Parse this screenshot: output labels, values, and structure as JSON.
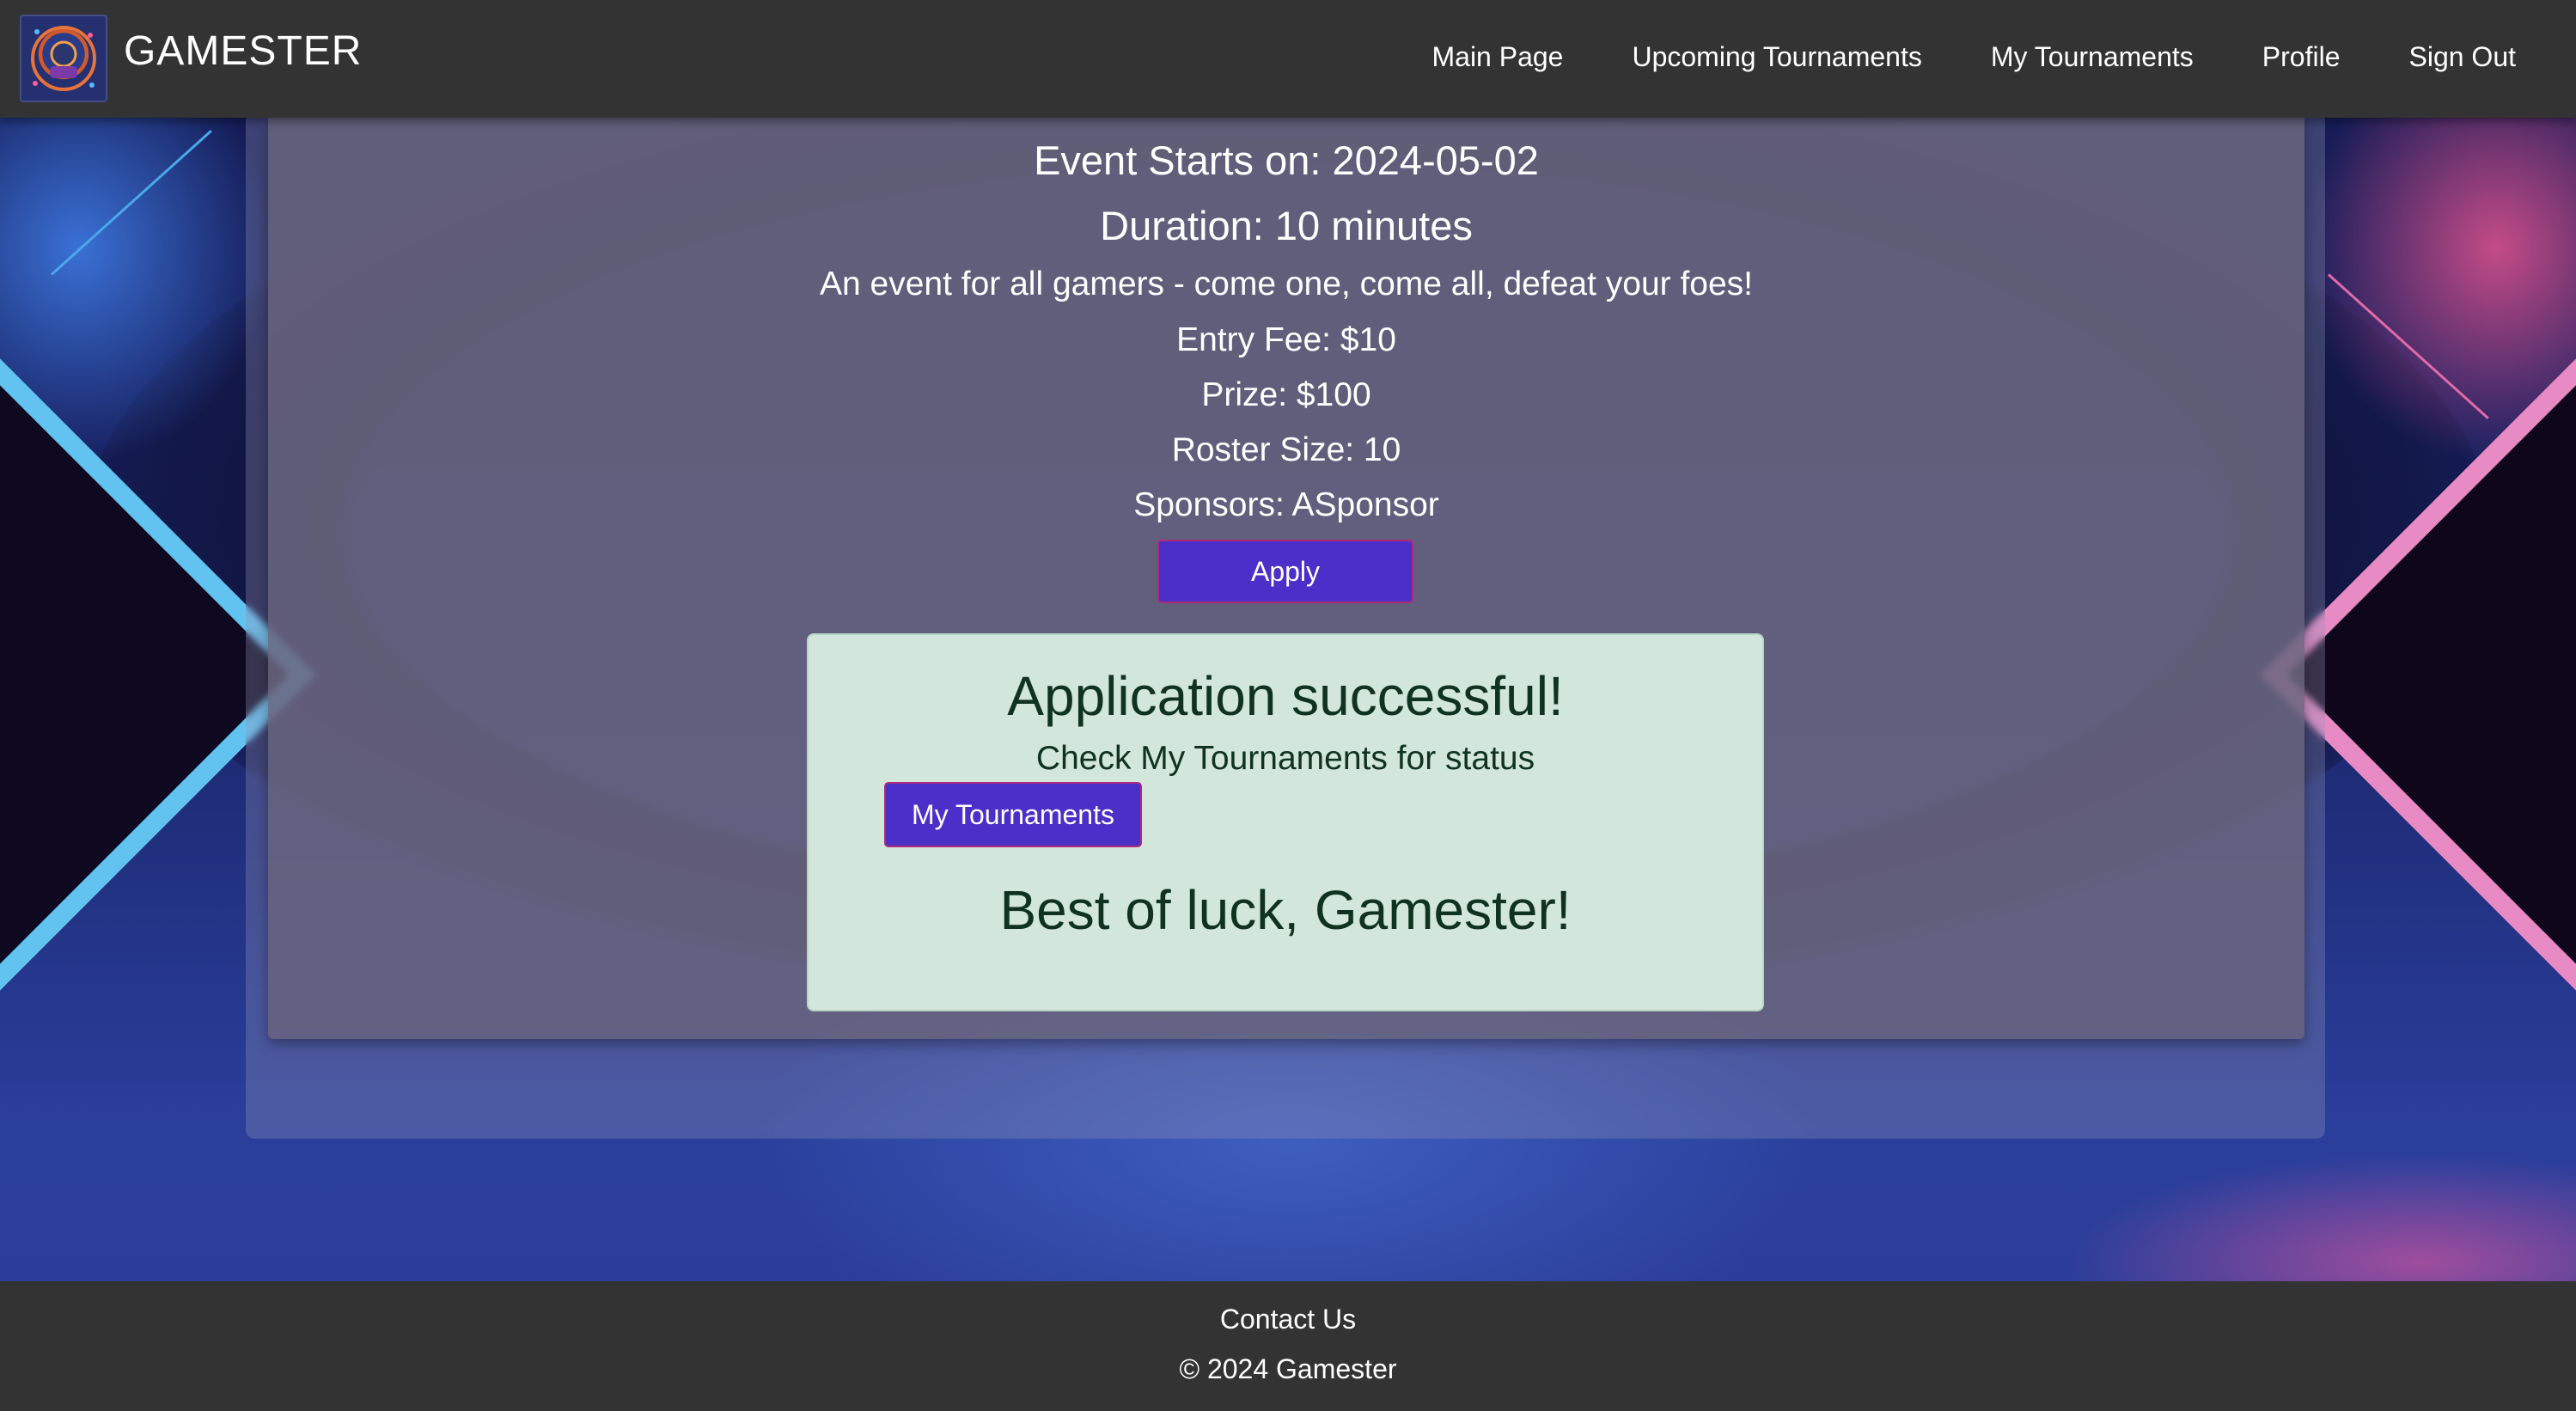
{
  "header": {
    "brand": "GAMESTER",
    "nav": [
      "Main Page",
      "Upcoming Tournaments",
      "My Tournaments",
      "Profile",
      "Sign Out"
    ]
  },
  "event": {
    "starts": "Event Starts on: 2024-05-02",
    "duration": "Duration: 10 minutes",
    "description": "An event for all gamers - come one, come all, defeat your foes!",
    "entry_fee": "Entry Fee: $10",
    "prize": "Prize: $100",
    "roster_size": "Roster Size: 10",
    "sponsors": "Sponsors: ASponsor",
    "apply_label": "Apply"
  },
  "success": {
    "title": "Application successful!",
    "subtitle": "Check My Tournaments for status",
    "button_label": "My Tournaments",
    "farewell": "Best of luck, Gamester!"
  },
  "footer": {
    "contact": "Contact Us",
    "copyright": "© 2024 Gamester"
  },
  "colors": {
    "header_bg": "#333333",
    "button_bg": "#4a30c8",
    "button_border": "#b0287a",
    "success_bg": "#d3e6dc",
    "success_text": "#0f3320"
  },
  "icons": {
    "logo": "gamester-logo-icon"
  }
}
